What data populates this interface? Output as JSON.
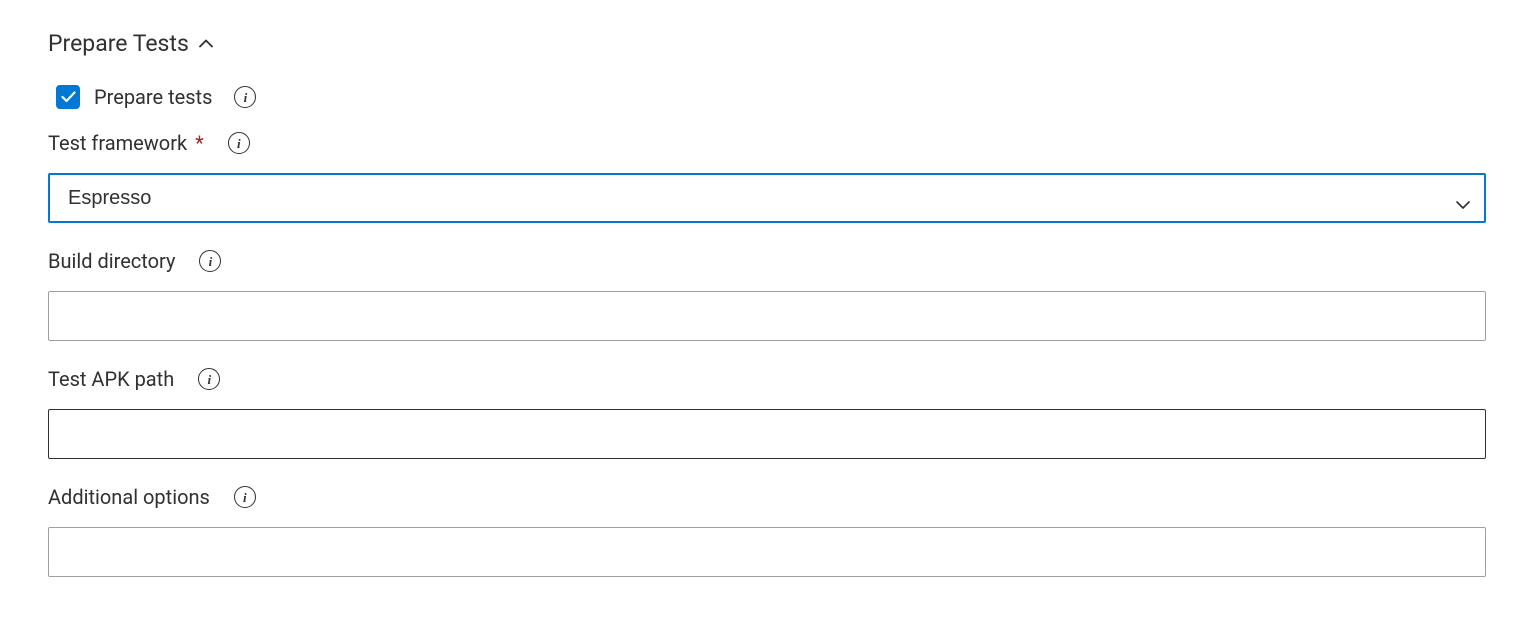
{
  "section": {
    "title": "Prepare Tests"
  },
  "checkbox": {
    "label": "Prepare tests",
    "checked": true
  },
  "fields": {
    "testFramework": {
      "label": "Test framework",
      "required": true,
      "value": "Espresso"
    },
    "buildDirectory": {
      "label": "Build directory",
      "value": ""
    },
    "testApkPath": {
      "label": "Test APK path",
      "value": ""
    },
    "additionalOptions": {
      "label": "Additional options",
      "value": ""
    }
  }
}
